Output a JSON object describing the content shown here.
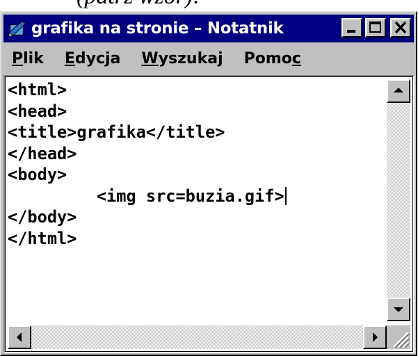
{
  "caption": {
    "text": "(patrz wzór):"
  },
  "window": {
    "title": "grafika na stronie – Notatnik",
    "icon": "notepad-icon",
    "controls": {
      "minimize": "minimize-icon",
      "maximize": "maximize-icon",
      "close": "close-icon"
    }
  },
  "menu": [
    {
      "pre": "",
      "key": "P",
      "post": "lik"
    },
    {
      "pre": "",
      "key": "E",
      "post": "dycja"
    },
    {
      "pre": "",
      "key": "W",
      "post": "yszukaj"
    },
    {
      "pre": "Pomo",
      "key": "c",
      "post": ""
    }
  ],
  "editor": {
    "lines": [
      "<html>",
      "<head>",
      "<title>grafika</title>",
      "</head>",
      "<body>",
      "         <img src=buzia.gif>",
      "</body>",
      "</html>"
    ],
    "caret_line": 6
  },
  "scrollbars": {
    "up": "arrow-up-icon",
    "down": "arrow-down-icon",
    "left": "arrow-left-icon",
    "right": "arrow-right-icon",
    "grip": "resize-grip-icon"
  }
}
